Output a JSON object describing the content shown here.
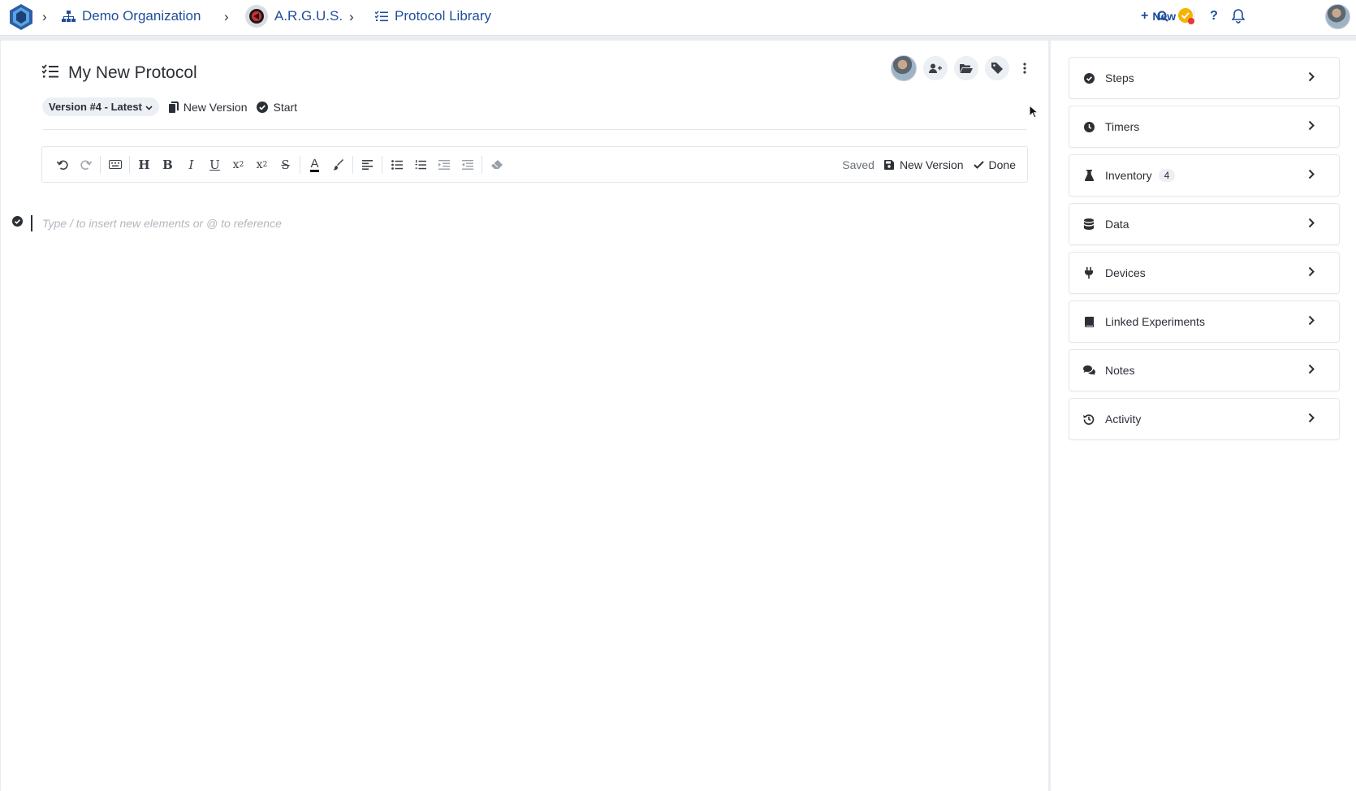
{
  "breadcrumb": {
    "org": "Demo Organization",
    "project": "A.R.G.U.S.",
    "library": "Protocol Library"
  },
  "topbar": {
    "new_label": "New"
  },
  "protocol": {
    "title": "My New Protocol",
    "version": "Version #4 - Latest",
    "new_version": "New Version",
    "start": "Start"
  },
  "editor": {
    "status": "Saved",
    "new_version": "New Version",
    "done": "Done",
    "placeholder": "Type / to insert new elements or @ to reference"
  },
  "sidebar": {
    "items": [
      {
        "label": "Steps",
        "icon": "check-circle-icon"
      },
      {
        "label": "Timers",
        "icon": "clock-icon"
      },
      {
        "label": "Inventory",
        "icon": "flask-icon",
        "badge": "4"
      },
      {
        "label": "Data",
        "icon": "database-icon"
      },
      {
        "label": "Devices",
        "icon": "plug-icon"
      },
      {
        "label": "Linked Experiments",
        "icon": "book-icon"
      },
      {
        "label": "Notes",
        "icon": "comments-icon"
      },
      {
        "label": "Activity",
        "icon": "history-icon"
      }
    ]
  },
  "colors": {
    "accent": "#1f4e9c",
    "background": "#e9ecf1",
    "notification_dot": "#e53935",
    "status_badge": "#f4b400"
  }
}
